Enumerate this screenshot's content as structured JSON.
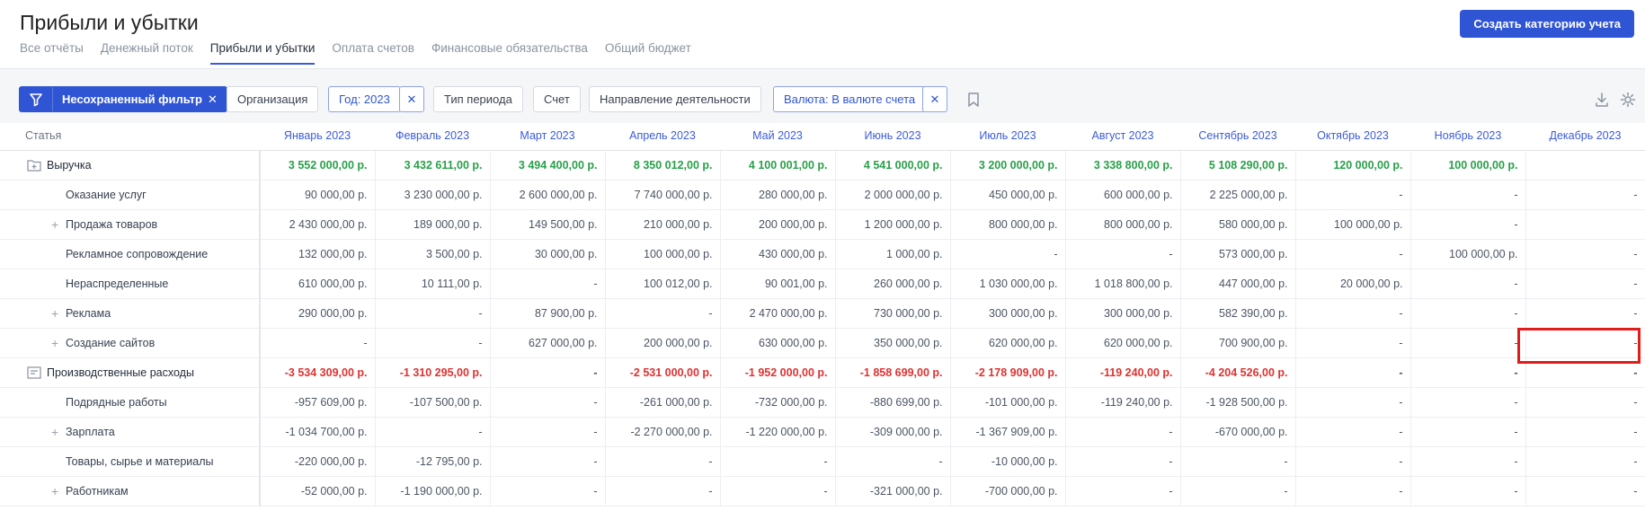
{
  "header": {
    "title": "Прибыли и убытки",
    "create_button": "Создать категорию учета",
    "tabs": [
      {
        "label": "Все отчёты",
        "active": false
      },
      {
        "label": "Денежный поток",
        "active": false
      },
      {
        "label": "Прибыли и убытки",
        "active": true
      },
      {
        "label": "Оплата счетов",
        "active": false
      },
      {
        "label": "Финансовые обязательства",
        "active": false
      },
      {
        "label": "Общий бюджет",
        "active": false
      }
    ]
  },
  "filters": {
    "saved_filter": "Несохраненный фильтр",
    "organization": "Организация",
    "year": "Год: 2023",
    "period_type": "Тип периода",
    "account": "Счет",
    "direction": "Направление деятельности",
    "currency": "Валюта: В валюте счета"
  },
  "table": {
    "article_header": "Статья",
    "months": [
      "Январь 2023",
      "Февраль 2023",
      "Март 2023",
      "Апрель 2023",
      "Май 2023",
      "Июнь 2023",
      "Июль 2023",
      "Август 2023",
      "Сентябрь 2023",
      "Октябрь 2023",
      "Ноябрь 2023",
      "Декабрь 2023"
    ],
    "rows": [
      {
        "name": "Выручка",
        "type": "group",
        "icon": "folder-plus-icon",
        "tone": "pos",
        "values": [
          "3 552 000,00 р.",
          "3 432 611,00 р.",
          "3 494 400,00 р.",
          "8 350 012,00 р.",
          "4 100 001,00 р.",
          "4 541 000,00 р.",
          "3 200 000,00 р.",
          "3 338 800,00 р.",
          "5 108 290,00 р.",
          "120 000,00 р.",
          "100 000,00 р.",
          ""
        ]
      },
      {
        "name": "Оказание услуг",
        "type": "sub",
        "expand": false,
        "values": [
          "90 000,00 р.",
          "3 230 000,00 р.",
          "2 600 000,00 р.",
          "7 740 000,00 р.",
          "280 000,00 р.",
          "2 000 000,00 р.",
          "450 000,00 р.",
          "600 000,00 р.",
          "2 225 000,00 р.",
          "-",
          "-",
          "-"
        ]
      },
      {
        "name": "Продажа товаров",
        "type": "sub",
        "expand": true,
        "values": [
          "2 430 000,00 р.",
          "189 000,00 р.",
          "149 500,00 р.",
          "210 000,00 р.",
          "200 000,00 р.",
          "1 200 000,00 р.",
          "800 000,00 р.",
          "800 000,00 р.",
          "580 000,00 р.",
          "100 000,00 р.",
          "-",
          ""
        ]
      },
      {
        "name": "Рекламное сопровождение",
        "type": "sub",
        "expand": false,
        "values": [
          "132 000,00 р.",
          "3 500,00 р.",
          "30 000,00 р.",
          "100 000,00 р.",
          "430 000,00 р.",
          "1 000,00 р.",
          "-",
          "-",
          "573 000,00 р.",
          "-",
          "100 000,00 р.",
          "-"
        ]
      },
      {
        "name": "Нераспределенные",
        "type": "sub",
        "expand": false,
        "values": [
          "610 000,00 р.",
          "10 111,00 р.",
          "-",
          "100 012,00 р.",
          "90 001,00 р.",
          "260 000,00 р.",
          "1 030 000,00 р.",
          "1 018 800,00 р.",
          "447 000,00 р.",
          "20 000,00 р.",
          "-",
          "-"
        ]
      },
      {
        "name": "Реклама",
        "type": "sub",
        "expand": true,
        "values": [
          "290 000,00 р.",
          "-",
          "87 900,00 р.",
          "-",
          "2 470 000,00 р.",
          "730 000,00 р.",
          "300 000,00 р.",
          "300 000,00 р.",
          "582 390,00 р.",
          "-",
          "-",
          "-"
        ]
      },
      {
        "name": "Создание сайтов",
        "type": "sub",
        "expand": true,
        "values": [
          "-",
          "-",
          "627 000,00 р.",
          "200 000,00 р.",
          "630 000,00 р.",
          "350 000,00 р.",
          "620 000,00 р.",
          "620 000,00 р.",
          "700 900,00 р.",
          "-",
          "-",
          "-"
        ]
      },
      {
        "name": "Производственные расходы",
        "type": "group",
        "icon": "list-box-icon",
        "tone": "neg",
        "values": [
          "-3 534 309,00 р.",
          "-1 310 295,00 р.",
          "-",
          "-2 531 000,00 р.",
          "-1 952 000,00 р.",
          "-1 858 699,00 р.",
          "-2 178 909,00 р.",
          "-119 240,00 р.",
          "-4 204 526,00 р.",
          "-",
          "-",
          "-"
        ]
      },
      {
        "name": "Подрядные работы",
        "type": "sub",
        "expand": false,
        "values": [
          "-957 609,00 р.",
          "-107 500,00 р.",
          "-",
          "-261 000,00 р.",
          "-732 000,00 р.",
          "-880 699,00 р.",
          "-101 000,00 р.",
          "-119 240,00 р.",
          "-1 928 500,00 р.",
          "-",
          "-",
          "-"
        ]
      },
      {
        "name": "Зарплата",
        "type": "sub",
        "expand": true,
        "values": [
          "-1 034 700,00 р.",
          "-",
          "-",
          "-2 270 000,00 р.",
          "-1 220 000,00 р.",
          "-309 000,00 р.",
          "-1 367 909,00 р.",
          "-",
          "-670 000,00 р.",
          "-",
          "-",
          "-"
        ]
      },
      {
        "name": "Товары, сырье и материалы",
        "type": "sub",
        "expand": false,
        "values": [
          "-220 000,00 р.",
          "-12 795,00 р.",
          "-",
          "-",
          "-",
          "-",
          "-10 000,00 р.",
          "-",
          "-",
          "-",
          "-",
          "-"
        ]
      },
      {
        "name": "Работникам",
        "type": "sub",
        "expand": true,
        "values": [
          "-52 000,00 р.",
          "-1 190 000,00 р.",
          "-",
          "-",
          "-",
          "-321 000,00 р.",
          "-700 000,00 р.",
          "-",
          "-",
          "-",
          "-",
          "-"
        ]
      }
    ]
  }
}
